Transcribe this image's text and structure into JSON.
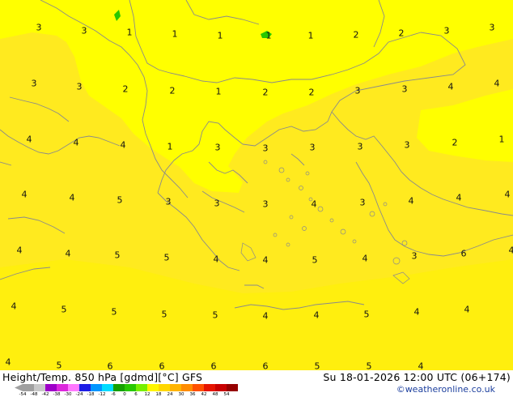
{
  "header": {
    "title_left": "Height/Temp. 850 hPa [gdmd][°C] GFS",
    "title_right": "Su 18-01-2026 12:00 UTC (06+174)",
    "credit": "©weatheronline.co.uk"
  },
  "colors": {
    "bright_yellow": "#ffff00",
    "warm_yellow": "#ffea1f",
    "mid_yellow": "#fff200",
    "coast": "#8a8a8a",
    "credit_blue": "#1c3f9e"
  },
  "colorbar": {
    "labels": [
      "-54",
      "-48",
      "-42",
      "-38",
      "-30",
      "-24",
      "-18",
      "-12",
      "-6",
      "0",
      "6",
      "12",
      "18",
      "24",
      "30",
      "36",
      "42",
      "48",
      "54"
    ],
    "colors": [
      "#a0a0a0",
      "#c8c8c8",
      "#9e00c8",
      "#dc28dc",
      "#ff78ff",
      "#1e1ee6",
      "#0096ff",
      "#00dcff",
      "#14a000",
      "#28c800",
      "#78f000",
      "#fff500",
      "#ffd700",
      "#ffb400",
      "#ff8c00",
      "#ff5000",
      "#e61400",
      "#c80000",
      "#960000"
    ]
  },
  "isotherms": [
    {
      "v": "3"
    },
    {
      "v": "3"
    },
    {
      "v": "1"
    },
    {
      "v": "1"
    },
    {
      "v": "1"
    },
    {
      "v": "1"
    },
    {
      "v": "1"
    },
    {
      "v": "2"
    },
    {
      "v": "2"
    },
    {
      "v": "3"
    },
    {
      "v": "3"
    },
    {
      "v": "3"
    },
    {
      "v": "3"
    },
    {
      "v": "2"
    },
    {
      "v": "2"
    },
    {
      "v": "1"
    },
    {
      "v": "2"
    },
    {
      "v": "2"
    },
    {
      "v": "3"
    },
    {
      "v": "3"
    },
    {
      "v": "4"
    },
    {
      "v": "4"
    },
    {
      "v": "4"
    },
    {
      "v": "4"
    },
    {
      "v": "4"
    },
    {
      "v": "1"
    },
    {
      "v": "3"
    },
    {
      "v": "3"
    },
    {
      "v": "3"
    },
    {
      "v": "3"
    },
    {
      "v": "3"
    },
    {
      "v": "2"
    },
    {
      "v": "1"
    },
    {
      "v": "4"
    },
    {
      "v": "4"
    },
    {
      "v": "5"
    },
    {
      "v": "3"
    },
    {
      "v": "3"
    },
    {
      "v": "3"
    },
    {
      "v": "4"
    },
    {
      "v": "3"
    },
    {
      "v": "4"
    },
    {
      "v": "4"
    },
    {
      "v": "4"
    },
    {
      "v": "4"
    },
    {
      "v": "4"
    },
    {
      "v": "5"
    },
    {
      "v": "5"
    },
    {
      "v": "4"
    },
    {
      "v": "4"
    },
    {
      "v": "5"
    },
    {
      "v": "4"
    },
    {
      "v": "3"
    },
    {
      "v": "6"
    },
    {
      "v": "4"
    },
    {
      "v": "4"
    },
    {
      "v": "5"
    },
    {
      "v": "5"
    },
    {
      "v": "5"
    },
    {
      "v": "5"
    },
    {
      "v": "4"
    },
    {
      "v": "4"
    },
    {
      "v": "5"
    },
    {
      "v": "4"
    },
    {
      "v": "4"
    },
    {
      "v": "4"
    },
    {
      "v": "5"
    },
    {
      "v": "6"
    },
    {
      "v": "6"
    },
    {
      "v": "6"
    },
    {
      "v": "6"
    },
    {
      "v": "5"
    },
    {
      "v": "5"
    },
    {
      "v": "4"
    }
  ]
}
